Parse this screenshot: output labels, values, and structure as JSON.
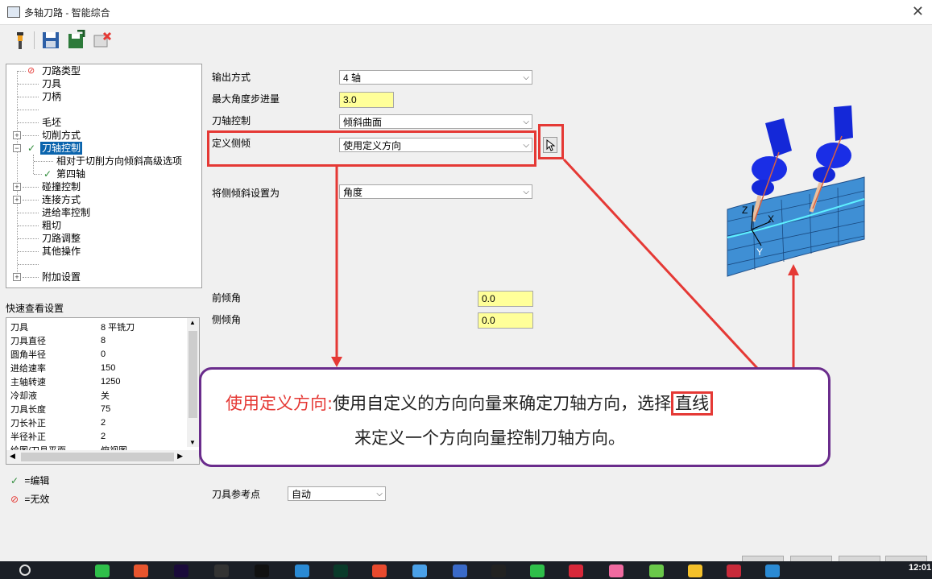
{
  "window": {
    "title": "多轴刀路 - 智能综合"
  },
  "toolbar": {
    "icons": [
      "tool-icon",
      "save-icon",
      "save-as-icon",
      "delete-icon"
    ]
  },
  "tree": [
    {
      "label": "刀路类型",
      "status": "invalid"
    },
    {
      "label": "刀具"
    },
    {
      "label": "刀柄"
    },
    {
      "label": ""
    },
    {
      "label": "毛坯"
    },
    {
      "label": "切削方式",
      "expandable": true
    },
    {
      "label": "刀轴控制",
      "expandable": true,
      "status": "edited",
      "selected": true
    },
    {
      "label": "相对于切削方向倾斜高级选项"
    },
    {
      "label": "第四轴",
      "status": "edited"
    },
    {
      "label": "碰撞控制",
      "expandable": true
    },
    {
      "label": "连接方式",
      "expandable": true
    },
    {
      "label": "进给率控制"
    },
    {
      "label": "粗切"
    },
    {
      "label": "刀路调整"
    },
    {
      "label": "其他操作"
    },
    {
      "label": ""
    },
    {
      "label": "附加设置",
      "expandable": true
    }
  ],
  "quick_view": {
    "title": "快速查看设置",
    "rows": [
      [
        "刀具",
        "8 平铣刀"
      ],
      [
        "刀具直径",
        "8"
      ],
      [
        "圆角半径",
        "0"
      ],
      [
        "进给速率",
        "150"
      ],
      [
        "主轴转速",
        "1250"
      ],
      [
        "冷却液",
        "关"
      ],
      [
        "刀具长度",
        "75"
      ],
      [
        "刀长补正",
        "2"
      ],
      [
        "半径补正",
        "2"
      ],
      [
        "绘图/刀具平面",
        "俯视图"
      ]
    ]
  },
  "legend": {
    "edited": "=编辑",
    "invalid": "=无效"
  },
  "form": {
    "output_label": "输出方式",
    "output_value": "4 轴",
    "max_angle_label": "最大角度步进量",
    "max_angle_value": "3.0",
    "axis_ctrl_label": "刀轴控制",
    "axis_ctrl_value": "倾斜曲面",
    "side_tilt_label": "定义侧倾",
    "side_tilt_value": "使用定义方向",
    "set_tilt_label": "将侧倾斜设置为",
    "set_tilt_value": "角度",
    "lead_angle_label": "前倾角",
    "lead_angle_value": "0.0",
    "side_angle_label": "侧倾角",
    "side_angle_value": "0.0",
    "ref_point_label": "刀具参考点",
    "ref_point_value": "自动"
  },
  "callout": {
    "term": "使用定义方向:",
    "text1": "使用自定义的方向向量来确定刀轴方向，选择",
    "highlight": "直线",
    "text2": "来定义一个方向向量控制刀轴方向。"
  },
  "illustration": {
    "axis_x": "X",
    "axis_y": "Y",
    "axis_z": "Z"
  },
  "taskbar": {
    "clock": "12:01"
  },
  "colors": {
    "callout_border": "#6a2c8c",
    "highlight_red": "#e53935",
    "selection": "#0a64ad",
    "input_yellow": "#ffff99"
  }
}
